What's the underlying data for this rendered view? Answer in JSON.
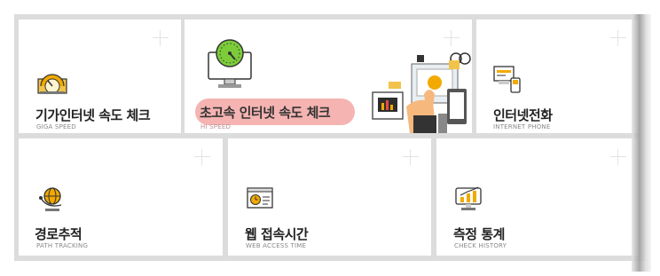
{
  "cards": [
    {
      "id": "giga",
      "title": "기가인터넷 속도 체크",
      "subtitle": "GIGA SPEED",
      "icon": "speedometer-icon"
    },
    {
      "id": "hi",
      "title": "초고속 인터넷 속도 체크",
      "subtitle": "HI SPEED",
      "icon": "monitor-speed-gauge-icon",
      "highlighted": true
    },
    {
      "id": "phone",
      "title": "인터넷전화",
      "subtitle": "INTERNET PHONE",
      "icon": "internet-phone-icon"
    },
    {
      "id": "path",
      "title": "경로추적",
      "subtitle": "PATH TRACKING",
      "icon": "globe-tracking-icon"
    },
    {
      "id": "web",
      "title": "웹 접속시간",
      "subtitle": "WEB ACCESS TIME",
      "icon": "web-browser-clock-icon"
    },
    {
      "id": "history",
      "title": "측정 통계",
      "subtitle": "CHECK HISTORY",
      "icon": "statistics-monitor-icon"
    }
  ],
  "colors": {
    "accent": "#f2a900",
    "highlight": "#f3a7a5",
    "gauge": "#7ccc3a"
  }
}
